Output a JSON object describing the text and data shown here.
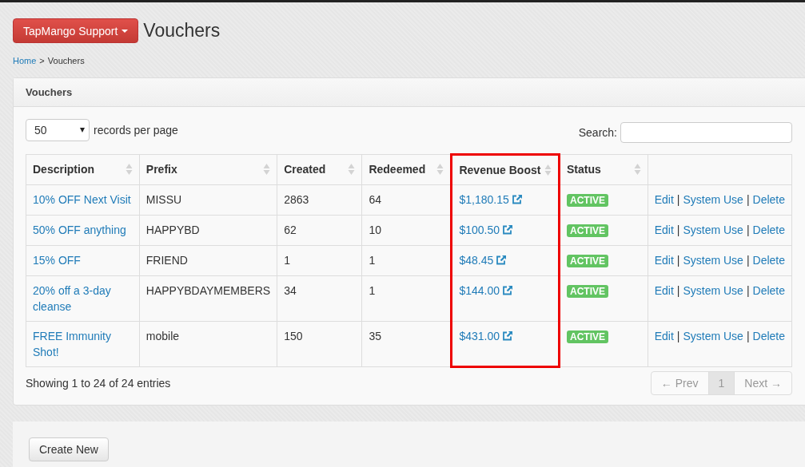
{
  "header": {
    "menu_button": "TapMango Support",
    "title": "Vouchers"
  },
  "breadcrumb": [
    {
      "text": "Home",
      "kind": "link"
    },
    {
      "text": ">",
      "kind": "sep"
    },
    {
      "text": "Vouchers",
      "kind": "current"
    }
  ],
  "panel": {
    "title": "Vouchers"
  },
  "page_size": {
    "value": "50",
    "label": "records per page"
  },
  "search": {
    "label": "Search:"
  },
  "table": {
    "columns": [
      {
        "label": "Description",
        "sortable": true,
        "highlighted": false
      },
      {
        "label": "Prefix",
        "sortable": true,
        "highlighted": false
      },
      {
        "label": "Created",
        "sortable": true,
        "highlighted": false
      },
      {
        "label": "Redeemed",
        "sortable": true,
        "highlighted": false
      },
      {
        "label": "Revenue Boost",
        "sortable": true,
        "highlighted": true
      },
      {
        "label": "Status",
        "sortable": true,
        "highlighted": false
      },
      {
        "sortable": false,
        "highlighted": false
      }
    ],
    "rows": [
      {
        "description": "10% OFF Next Visit",
        "prefix": "MISSU",
        "created": "2863",
        "redeemed": "64",
        "revenue": "$1,180.15",
        "status": {
          "label": "ACTIVE",
          "kind": "active"
        },
        "actions": [
          {
            "kind": "link",
            "text": "Edit"
          },
          {
            "kind": "sep",
            "text": "|"
          },
          {
            "kind": "link",
            "text": "System Use"
          },
          {
            "kind": "sep",
            "text": "|"
          },
          {
            "kind": "link",
            "text": "Delete"
          }
        ]
      },
      {
        "description": "50% OFF anything",
        "prefix": "HAPPYBD",
        "created": "62",
        "redeemed": "10",
        "revenue": "$100.50",
        "status": {
          "label": "ACTIVE",
          "kind": "active"
        },
        "actions": [
          {
            "kind": "link",
            "text": "Edit"
          },
          {
            "kind": "sep",
            "text": "|"
          },
          {
            "kind": "link",
            "text": "System Use"
          },
          {
            "kind": "sep",
            "text": "|"
          },
          {
            "kind": "link",
            "text": "Delete"
          }
        ]
      },
      {
        "description": "15% OFF",
        "prefix": "FRIEND",
        "created": "1",
        "redeemed": "1",
        "revenue": "$48.45",
        "status": {
          "label": "ACTIVE",
          "kind": "active"
        },
        "actions": [
          {
            "kind": "link",
            "text": "Edit"
          },
          {
            "kind": "sep",
            "text": "|"
          },
          {
            "kind": "link",
            "text": "System Use"
          },
          {
            "kind": "sep",
            "text": "|"
          },
          {
            "kind": "link",
            "text": "Delete"
          }
        ]
      },
      {
        "description": "20% off a 3-day cleanse",
        "prefix": "HAPPYBDAYMEMBERS",
        "created": "34",
        "redeemed": "1",
        "revenue": "$144.00",
        "status": {
          "label": "ACTIVE",
          "kind": "active"
        },
        "actions": [
          {
            "kind": "link",
            "text": "Edit"
          },
          {
            "kind": "sep",
            "text": "|"
          },
          {
            "kind": "link",
            "text": "System Use"
          },
          {
            "kind": "sep",
            "text": "|"
          },
          {
            "kind": "link",
            "text": "Delete"
          }
        ]
      },
      {
        "description": "FREE Immunity Shot!",
        "prefix": "mobile",
        "created": "150",
        "redeemed": "35",
        "revenue": "$431.00",
        "status": {
          "label": "ACTIVE",
          "kind": "active"
        },
        "actions": [
          {
            "kind": "link",
            "text": "Edit"
          },
          {
            "kind": "sep",
            "text": "|"
          },
          {
            "kind": "link",
            "text": "System Use"
          },
          {
            "kind": "sep",
            "text": "|"
          },
          {
            "kind": "link",
            "text": "Delete"
          }
        ]
      }
    ]
  },
  "footer": {
    "info": "Showing 1 to 24 of 24 entries"
  },
  "pagination": [
    {
      "label": "← Prev",
      "disabled": true,
      "selected": false
    },
    {
      "label": "1",
      "disabled": false,
      "selected": true
    },
    {
      "label": "Next →",
      "disabled": true,
      "selected": false
    }
  ],
  "create_button": "Create New"
}
